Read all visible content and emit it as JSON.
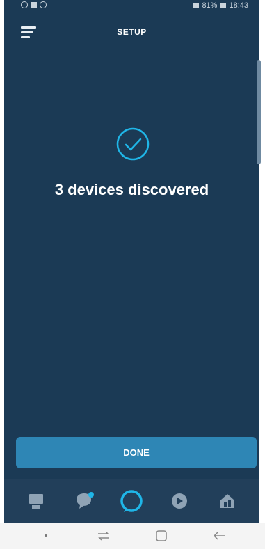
{
  "status_bar": {
    "time": "18:43",
    "battery": "81%"
  },
  "header": {
    "title": "SETUP"
  },
  "main": {
    "icon": "check-circle-icon",
    "message": "3 devices discovered"
  },
  "actions": {
    "done_label": "DONE"
  },
  "bottom_nav": {
    "items": [
      {
        "name": "home",
        "icon": "home-card-icon"
      },
      {
        "name": "communicate",
        "icon": "chat-bubble-icon"
      },
      {
        "name": "alexa",
        "icon": "alexa-ring-icon"
      },
      {
        "name": "play",
        "icon": "play-circle-icon"
      },
      {
        "name": "devices",
        "icon": "smart-home-icon"
      }
    ]
  },
  "colors": {
    "background": "#1b3a55",
    "accent": "#2e86b5",
    "icon_cyan": "#1fb6e8"
  }
}
